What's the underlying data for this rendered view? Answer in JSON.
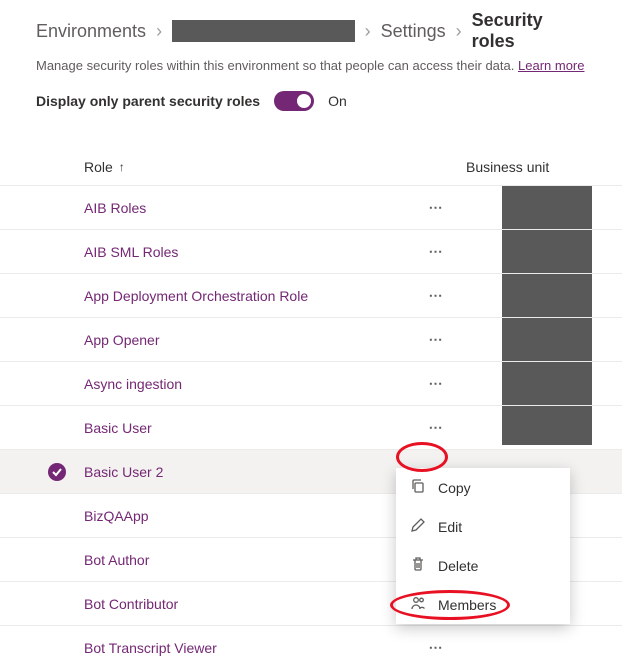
{
  "breadcrumb": {
    "environments": "Environments",
    "settings": "Settings",
    "current": "Security roles"
  },
  "subhead": {
    "text": "Manage security roles within this environment so that people can access their data.",
    "learn": "Learn more"
  },
  "toggle": {
    "label": "Display only parent security roles",
    "state": "On"
  },
  "columns": {
    "role": "Role",
    "bu": "Business unit"
  },
  "rows": [
    {
      "name": "AIB Roles",
      "selected": false
    },
    {
      "name": "AIB SML Roles",
      "selected": false
    },
    {
      "name": "App Deployment Orchestration Role",
      "selected": false
    },
    {
      "name": "App Opener",
      "selected": false
    },
    {
      "name": "Async ingestion",
      "selected": false
    },
    {
      "name": "Basic User",
      "selected": false
    },
    {
      "name": "Basic User 2",
      "selected": true
    },
    {
      "name": "BizQAApp",
      "selected": false
    },
    {
      "name": "Bot Author",
      "selected": false
    },
    {
      "name": "Bot Contributor",
      "selected": false
    },
    {
      "name": "Bot Transcript Viewer",
      "selected": false
    }
  ],
  "menu": {
    "copy": "Copy",
    "edit": "Edit",
    "delete": "Delete",
    "members": "Members"
  }
}
